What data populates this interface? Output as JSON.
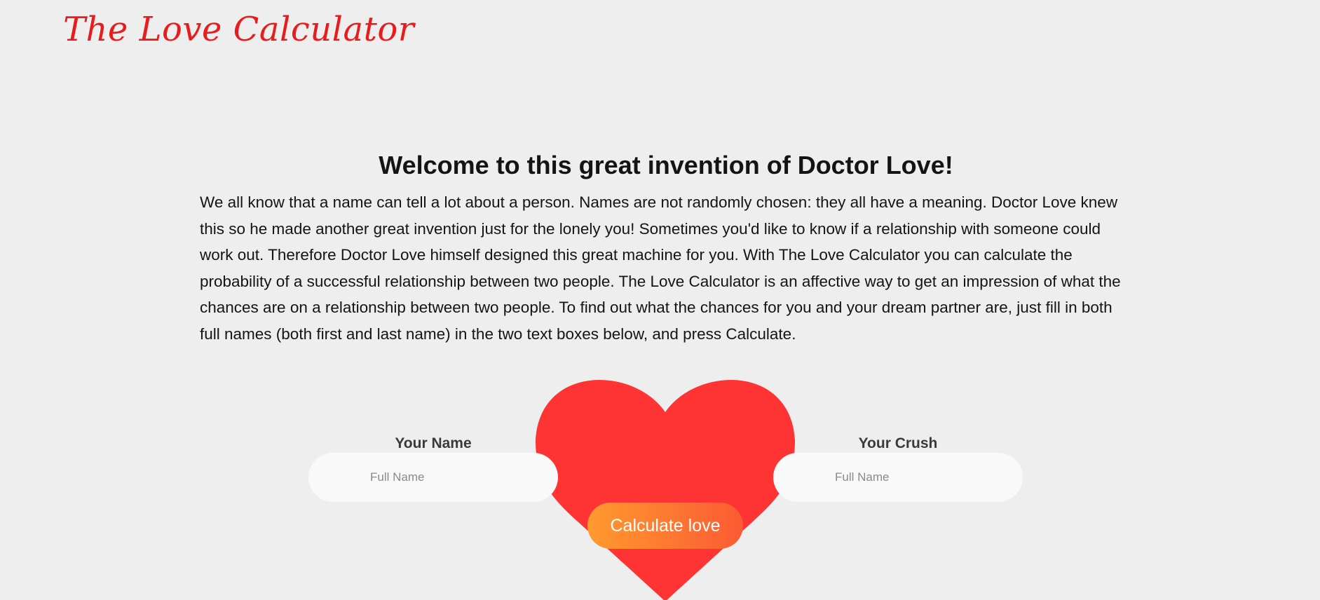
{
  "header": {
    "logo_text": "The Love Calculator"
  },
  "intro": {
    "heading": "Welcome to this great invention of Doctor Love!",
    "paragraph": "We all know that a name can tell a lot about a person. Names are not randomly chosen: they all have a meaning. Doctor Love knew this so he made another great invention just for the lonely you! Sometimes you'd like to know if a relationship with someone could work out. Therefore Doctor Love himself designed this great machine for you. With The Love Calculator you can calculate the probability of a successful relationship between two people. The Love Calculator is an affective way to get an impression of what the chances are on a relationship between two people. To find out what the chances for you and your dream partner are, just fill in both full names (both first and last name) in the two text boxes below, and press Calculate."
  },
  "form": {
    "your_name": {
      "label": "Your Name",
      "placeholder": "Full Name",
      "value": ""
    },
    "your_crush": {
      "label": "Your Crush",
      "placeholder": "Full Name",
      "value": ""
    },
    "submit_label": "Calculate love"
  },
  "colors": {
    "background": "#eeeeee",
    "logo": "#e81c1c",
    "heart": "#fe3333",
    "button_gradient_start": "#ff9a2e",
    "button_gradient_end": "#fb5a33",
    "input_background": "#f9f9f9"
  },
  "icons": {
    "heart": "heart-icon"
  }
}
